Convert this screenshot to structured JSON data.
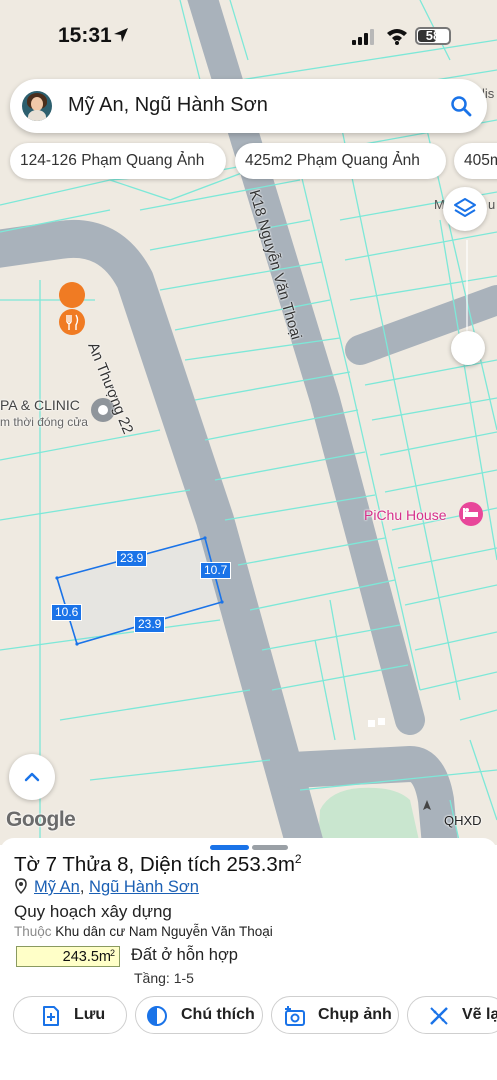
{
  "status_bar": {
    "time": "15:31",
    "battery": "58"
  },
  "search": {
    "query": "Mỹ An, Ngũ Hành Sơn"
  },
  "chips": [
    "124-126 Phạm Quang Ảnh",
    "425m2 Phạm Quang Ảnh",
    "405m"
  ],
  "map": {
    "labels": {
      "road_1": "An Thượng 22",
      "road_2": "K18 Nguyễn Văn Thoại",
      "poi_1_name": "PA & CLINIC",
      "poi_1_status": "m thời đóng cửa",
      "poi_2_name": "PiChu House",
      "edge_1": "lis",
      "edge_2": "M",
      "edge_3": "u"
    },
    "parcel_dimensions": {
      "top": "23.9",
      "right": "10.7",
      "left": "10.6",
      "bottom": "23.9"
    },
    "attribution": "Google",
    "map_source": "QHXD"
  },
  "parcel": {
    "title_main": "Tờ 7 Thửa 8, Diện tích 253.3m",
    "title_sup": "2",
    "ward": "Mỹ An",
    "district": "Ngũ Hành Sơn",
    "planning_heading": "Quy hoạch xây dựng",
    "belongs_label": "Thuộc",
    "belongs_value": "Khu dân cư Nam Nguyễn Văn Thoại",
    "area_value": "243.5m",
    "area_sup": "2",
    "land_use": "Đất ở hỗn hợp",
    "floors": "Tầng: 1-5"
  },
  "actions": {
    "save": "Lưu",
    "legend": "Chú thích",
    "capture": "Chụp ảnh",
    "draw": "Vẽ lạ"
  },
  "colors": {
    "accent": "#1a73e8",
    "parcel_lines": "#7de8d8",
    "road": "#a9b2bb",
    "map_bg": "#efeae1",
    "link": "#1a5fb4",
    "area_fill": "#ffffc8"
  }
}
